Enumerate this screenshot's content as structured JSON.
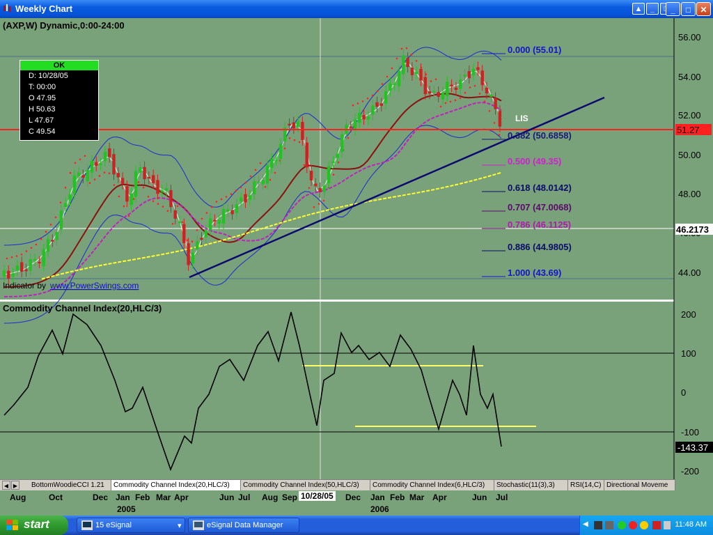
{
  "window": {
    "title": "Weekly Chart",
    "inner_buttons": [
      "▲",
      "_",
      "□"
    ],
    "outer_buttons": [
      "_",
      "□",
      "✕"
    ]
  },
  "chart": {
    "header": "(AXP,W) Dynamic,0:00-24:00",
    "info_box": {
      "status": "OK",
      "rows": [
        "D: 10/28/05",
        "T: 00:00",
        "O  47.95",
        "H  50.63",
        "L  47.67",
        "C  49.54"
      ]
    },
    "credit_text": "Indicator by",
    "credit_link": "www.PowerSwings.com",
    "lis_label": "LIS",
    "price_axis": [
      "56.00",
      "54.00",
      "52.00",
      "50.00",
      "48.00",
      "46.00",
      "44.00"
    ],
    "price_tag_current": "51.27",
    "price_tag_cursor": "46.2173",
    "fib_levels": [
      {
        "label": "0.000",
        "value": "(55.01)",
        "color": "#1515c8"
      },
      {
        "label": "0.382",
        "value": "(50.6858)",
        "color": "#1a1a7a"
      },
      {
        "label": "0.500",
        "value": "(49.35)",
        "color": "#cc22cc"
      },
      {
        "label": "0.618",
        "value": "(48.0142)",
        "color": "#0b0b6b"
      },
      {
        "label": "0.707",
        "value": "(47.0068)",
        "color": "#5a0a6a"
      },
      {
        "label": "0.786",
        "value": "(46.1125)",
        "color": "#aa1caa"
      },
      {
        "label": "0.886",
        "value": "(44.9805)",
        "color": "#0b0b6b"
      },
      {
        "label": "1.000",
        "value": "(43.69)",
        "color": "#1515c8"
      }
    ],
    "colors": {
      "background": "#7aa27a",
      "up_candle": "#22c222",
      "down_candle": "#cc2222",
      "trendline": "#0a0a6e",
      "bollinger": "#1a2ad0",
      "ma_red": "#8b1010",
      "ma_magenta": "#c020c0",
      "ma_yellow": "#ffff33",
      "support_line": "#ff2020"
    }
  },
  "cci": {
    "title": "Commodity Channel Index(20,HLC/3)",
    "axis": [
      "200",
      "100",
      "0",
      "-100",
      "-200"
    ],
    "current_value": "-143.37"
  },
  "tabs": [
    "BottomWoodieCCI 1.21",
    "Commodity Channel Index(20,HLC/3)",
    "Commodity Channel Index(50,HLC/3)",
    "Commodity Channel Index(6,HLC/3)",
    "Stochastic(11(3),3)",
    "RSI(14,C)",
    "Directional Moveme"
  ],
  "x_axis": {
    "months": [
      "Aug",
      "Oct",
      "Dec",
      "Jan",
      "Feb",
      "Mar",
      "Apr",
      "Jun",
      "Jul",
      "Aug",
      "Sep",
      "Dec",
      "Jan",
      "Feb",
      "Mar",
      "Apr",
      "Jun",
      "Jul"
    ],
    "years": [
      "2005",
      "2006"
    ],
    "cursor_date": "10/28/05"
  },
  "taskbar": {
    "start": "start",
    "tasks": [
      "15 eSignal",
      "eSignal Data Manager"
    ],
    "clock": "11:48 AM"
  }
}
